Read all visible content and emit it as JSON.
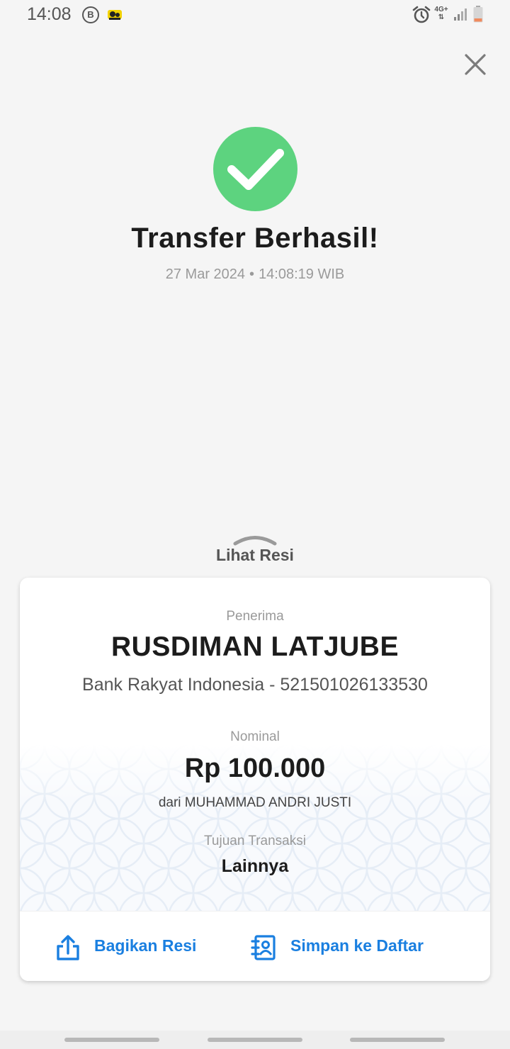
{
  "status_bar": {
    "time": "14:08",
    "b_badge": "B",
    "network": "4G+",
    "icons": [
      "b-circle-icon",
      "app-notification-icon",
      "alarm-icon",
      "network-4g-icon",
      "signal-icon",
      "battery-icon"
    ]
  },
  "header": {
    "close_icon": "close-icon"
  },
  "result": {
    "icon": "check-circle-icon",
    "success_color": "#5dd37f",
    "title": "Transfer Berhasil!",
    "date": "27 Mar 2024",
    "separator": "•",
    "time": "14:08:19 WIB"
  },
  "receipt_toggle": {
    "label": "Lihat Resi",
    "icon": "chevron-up-icon"
  },
  "receipt": {
    "recipient_label": "Penerima",
    "recipient_name": "RUSDIMAN LATJUBE",
    "recipient_bank": "Bank Rakyat Indonesia - 521501026133530",
    "amount_label": "Nominal",
    "amount": "Rp 100.000",
    "sender": "dari MUHAMMAD ANDRI JUSTI",
    "purpose_label": "Tujuan Transaksi",
    "purpose": "Lainnya"
  },
  "actions": {
    "accent_color": "#1a7fe0",
    "share_label": "Bagikan Resi",
    "share_icon": "share-icon",
    "save_label": "Simpan ke Daftar",
    "save_icon": "contact-book-icon"
  }
}
